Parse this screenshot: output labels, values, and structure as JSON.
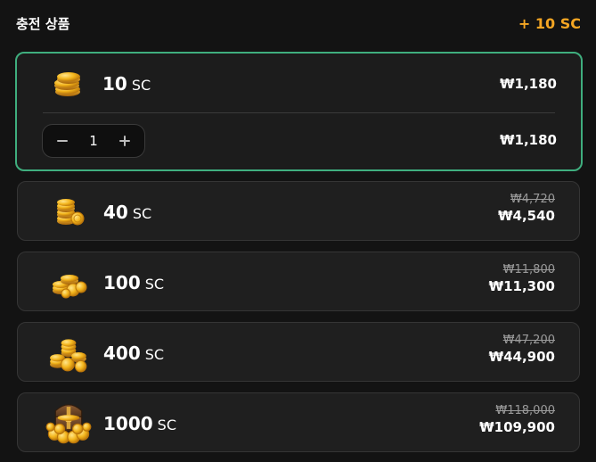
{
  "header": {
    "title": "충전 상품",
    "bonus": "+ 10 SC"
  },
  "selected": {
    "amount": "10",
    "unit": "SC",
    "price": "₩1,180",
    "stepper_value": "1",
    "total": "₩1,180",
    "icon": "coins-small-icon"
  },
  "products": [
    {
      "amount": "40",
      "unit": "SC",
      "old_price": "₩4,720",
      "price": "₩4,540",
      "icon": "coin-stack-icon"
    },
    {
      "amount": "100",
      "unit": "SC",
      "old_price": "₩11,800",
      "price": "₩11,300",
      "icon": "coin-pile-icon"
    },
    {
      "amount": "400",
      "unit": "SC",
      "old_price": "₩47,200",
      "price": "₩44,900",
      "icon": "coin-heap-icon"
    },
    {
      "amount": "1000",
      "unit": "SC",
      "old_price": "₩118,000",
      "price": "₩109,900",
      "icon": "treasure-chest-icon"
    }
  ],
  "colors": {
    "accent": "#f5a623",
    "selected_border": "#3fae7e",
    "background": "#131313",
    "card": "#1f1f1f"
  }
}
